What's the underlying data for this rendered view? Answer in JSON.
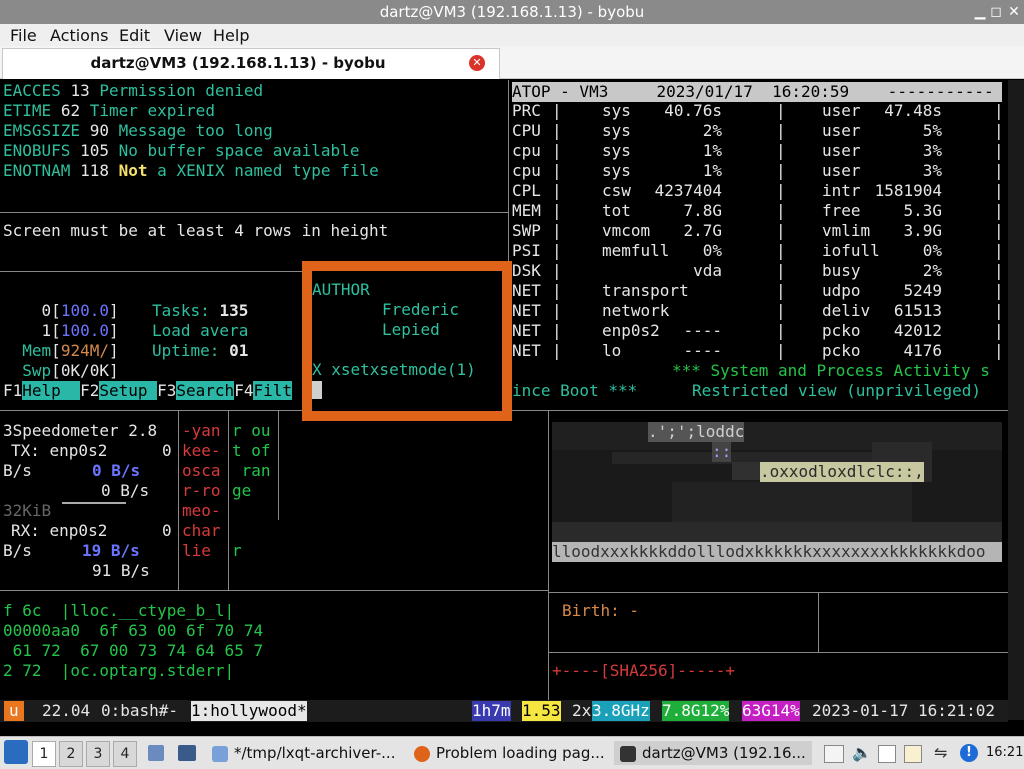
{
  "window": {
    "title": "dartz@VM3 (192.168.1.13) - byobu"
  },
  "menu": [
    "File",
    "Actions",
    "Edit",
    "View",
    "Help"
  ],
  "tab": {
    "label": "dartz@VM3 (192.168.1.13) - byobu"
  },
  "errors": [
    {
      "code": "EACCES",
      "num": "13",
      "msg": "Permission denied"
    },
    {
      "code": "ETIME",
      "num": "62",
      "msg": "Timer expired"
    },
    {
      "code": "EMSGSIZE",
      "num": "90",
      "msg": "Message too long"
    },
    {
      "code": "ENOBUFS",
      "num": "105",
      "msg": "No buffer space available"
    },
    {
      "code": "ENOTNAM",
      "num": "118",
      "msg_strong": "Not",
      "msg": "a XENIX named type file"
    }
  ],
  "screen_msg": "Screen must be at least 4 rows in height",
  "htop": {
    "cpu0": {
      "idx": "0",
      "val": "100.0"
    },
    "cpu1": {
      "idx": "1",
      "val": "100.0"
    },
    "mem": {
      "label": "Mem",
      "val": "924M/"
    },
    "swp": {
      "label": "Swp",
      "val": "0K/0K"
    },
    "tasks_label": "Tasks:",
    "tasks": "135",
    "load_label": "Load avera",
    "uptime_label": "Uptime:",
    "uptime": "01",
    "fkeys": [
      {
        "key": "F1",
        "label": "Help  "
      },
      {
        "key": "F2",
        "label": "Setup "
      },
      {
        "key": "F3",
        "label": "Search"
      },
      {
        "key": "F4",
        "label": "Filt"
      }
    ]
  },
  "overlay": {
    "heading": "AUTHOR",
    "name1": "Frederic",
    "name2": "Lepied",
    "footer": "X xsetxsetmode(1)"
  },
  "atop": {
    "header": "ATOP - VM3     2023/01/17  16:20:59    -----------",
    "rows": [
      {
        "a": "PRC",
        "b": "sys",
        "c": "40.76s",
        "d": "user",
        "e": "47.48s"
      },
      {
        "a": "CPU",
        "b": "sys",
        "c": "2%",
        "d": "user",
        "e": "5%"
      },
      {
        "a": "cpu",
        "b": "sys",
        "c": "1%",
        "d": "user",
        "e": "3%"
      },
      {
        "a": "cpu",
        "b": "sys",
        "c": "1%",
        "d": "user",
        "e": "3%"
      },
      {
        "a": "CPL",
        "b": "csw",
        "c": "4237404",
        "d": "intr",
        "e": "1581904"
      },
      {
        "a": "MEM",
        "b": "tot",
        "c": "7.8G",
        "d": "free",
        "e": "5.3G"
      },
      {
        "a": "SWP",
        "b": "vmcom",
        "c": "2.7G",
        "d": "vmlim",
        "e": "3.9G"
      },
      {
        "a": "PSI",
        "b": "memfull",
        "c": "0%",
        "d": "iofull",
        "e": "0%"
      },
      {
        "a": "DSK",
        "b": "",
        "c": "vda",
        "d": "busy",
        "e": "2%"
      },
      {
        "a": "NET",
        "b": "transport",
        "c": "",
        "d": "udpo",
        "e": "5249"
      },
      {
        "a": "NET",
        "b": "network",
        "c": "",
        "d": "deliv",
        "e": "61513"
      },
      {
        "a": "NET",
        "b": "enp0s2",
        "c": "----",
        "d": "pcko",
        "e": "42012"
      },
      {
        "a": "NET",
        "b": "lo",
        "c": "----",
        "d": "pcko",
        "e": "4176"
      }
    ],
    "banner": "*** System and Process Activity s",
    "since": "ince Boot ***",
    "restricted": "Restricted view (unprivileged)"
  },
  "speedo": {
    "title": "3Speedometer 2.8",
    "tx": "TX: enp0s2",
    "tx_zero": "0",
    "bs1": "B/s",
    "tx_rate": "0 B/s",
    "tx_rate2": "0 B/s",
    "kib": "32KiB",
    "rx": "RX: enp0s2",
    "rx_zero": "0",
    "bs2": "B/s",
    "rx_rate": "19 B/s",
    "rx_rate2": "91 B/s"
  },
  "redcol": [
    "-yan",
    "kee-",
    "osca",
    "r-ro",
    "meo-",
    "char",
    "lie"
  ],
  "greencol": [
    "r ou",
    "t of",
    " ran",
    "ge",
    "",
    "",
    "r"
  ],
  "hex": {
    "l1": "f 6c  |lloc.__ctype_b_l|",
    "l2": "00000aa0  6f 63 00 6f 70 74",
    "l3": " 61 72  67 00 73 74 64 65 7",
    "l4": "2 72  |oc.optarg.stderr|"
  },
  "noise": {
    "l1": ".';';loddc",
    "l2": "::",
    "l3": ".oxxodloxdlclc::,",
    "l4": "lloodxxxkkkkddolllodxkkkkkkxxxxxxxxkkkkkkkdoo"
  },
  "birth": "Birth: -",
  "sha": "+----[SHA256]-----+",
  "statusbar": {
    "u": "u",
    "load": "22.04",
    "win0": "0:bash#-",
    "win1": "1:hollywood*",
    "uptime": "1h7m",
    "loadavg": "1.53",
    "cpu": "2x",
    "ghz": "3.8GHz",
    "mem": "7.8G12%",
    "disk": "63G14%",
    "datetime": "2023-01-17 16:21:02"
  },
  "taskbar": {
    "workspaces": [
      "1",
      "2",
      "3",
      "4"
    ],
    "tasks": [
      "*/tmp/lxqt-archiver-...",
      "Problem loading pag...",
      "dartz@VM3 (192.16..."
    ],
    "clock": "16:21"
  },
  "colors": {
    "accent": "#e0631a",
    "teal": "#2ab7a8",
    "titlebar": "#8a8a8a"
  }
}
